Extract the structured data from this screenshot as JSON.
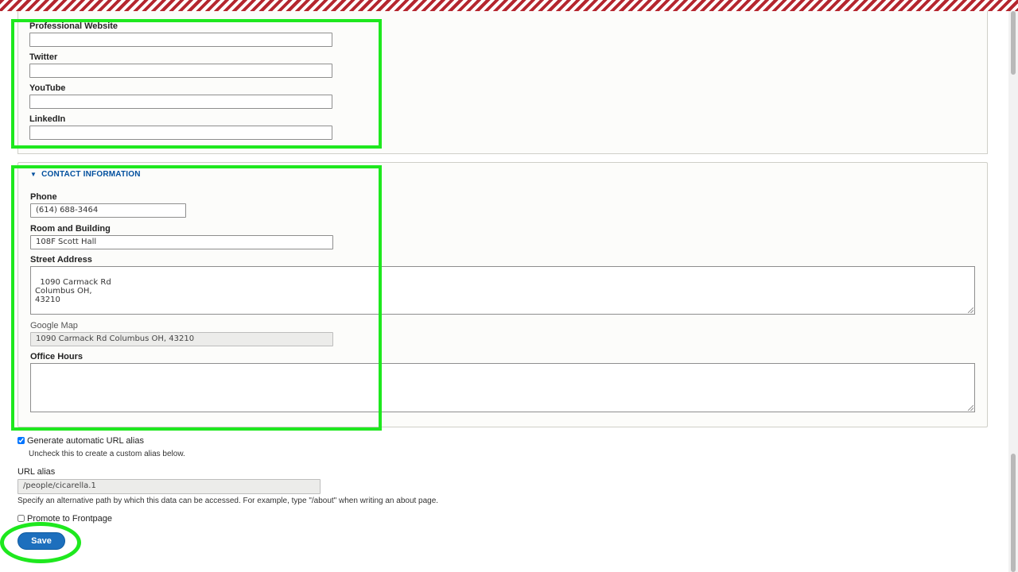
{
  "social": {
    "professional_website_label": "Professional Website",
    "professional_website_value": "",
    "twitter_label": "Twitter",
    "twitter_value": "",
    "youtube_label": "YouTube",
    "youtube_value": "",
    "linkedin_label": "LinkedIn",
    "linkedin_value": ""
  },
  "contact": {
    "section_title": "CONTACT INFORMATION",
    "phone_label": "Phone",
    "phone_value": "(614) 688-3464",
    "room_label": "Room and Building",
    "room_value": "108F Scott Hall",
    "street_label": "Street Address",
    "street_value": "1090 Carmack Rd\nColumbus OH,\n43210",
    "map_label": "Google Map",
    "map_value": "1090 Carmack Rd Columbus OH, 43210",
    "office_hours_label": "Office Hours",
    "office_hours_value": ""
  },
  "url": {
    "generate_alias_label": "Generate automatic URL alias",
    "generate_alias_checked": true,
    "generate_alias_desc": "Uncheck this to create a custom alias below.",
    "alias_label": "URL alias",
    "alias_value": "/people/cicarella.1",
    "alias_desc": "Specify an alternative path by which this data can be accessed. For example, type \"/about\" when writing an about page."
  },
  "promote": {
    "label": "Promote to Frontpage",
    "checked": false
  },
  "actions": {
    "save_label": "Save"
  },
  "colors": {
    "highlight": "#1ee81e",
    "primary_button": "#1d6fbd",
    "section_link": "#004f9e",
    "header_stripe": "#b5262f"
  }
}
